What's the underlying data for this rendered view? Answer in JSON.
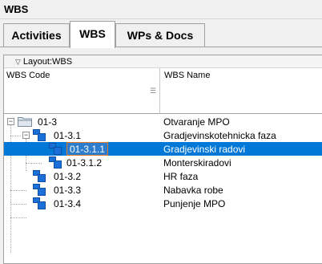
{
  "window": {
    "title": "WBS"
  },
  "tabs": [
    {
      "label": "Activities",
      "active": false
    },
    {
      "label": "WBS",
      "active": true
    },
    {
      "label": "WPs & Docs",
      "active": false
    }
  ],
  "grid": {
    "group_label": "Layout:WBS",
    "columns": {
      "code": "WBS Code",
      "name": "WBS Name"
    },
    "rows": [
      {
        "code": "01-3",
        "name": "Otvaranje MPO",
        "level": 0,
        "type": "folder",
        "expander": "−",
        "selected": false
      },
      {
        "code": "01-3.1",
        "name": "Gradjevinskotehnicka faza",
        "level": 1,
        "type": "wbs",
        "expander": "−",
        "selected": false
      },
      {
        "code": "01-3.1.1",
        "name": "Gradjevinski radovi",
        "level": 2,
        "type": "wbs",
        "expander": "",
        "selected": true
      },
      {
        "code": "01-3.1.2",
        "name": "Monterskiradovi",
        "level": 2,
        "type": "wbs",
        "expander": "",
        "selected": false
      },
      {
        "code": "01-3.2",
        "name": "HR faza",
        "level": 1,
        "type": "wbs",
        "expander": "",
        "selected": false
      },
      {
        "code": "01-3.3",
        "name": "Nabavka robe",
        "level": 1,
        "type": "wbs",
        "expander": "",
        "selected": false
      },
      {
        "code": "01-3.4",
        "name": "Punjenje MPO",
        "level": 1,
        "type": "wbs",
        "expander": "",
        "selected": false
      }
    ]
  },
  "colors": {
    "selection": "#0078d7",
    "wbs_icon": "#1a6fd8",
    "focus_border": "#e07b2a"
  }
}
